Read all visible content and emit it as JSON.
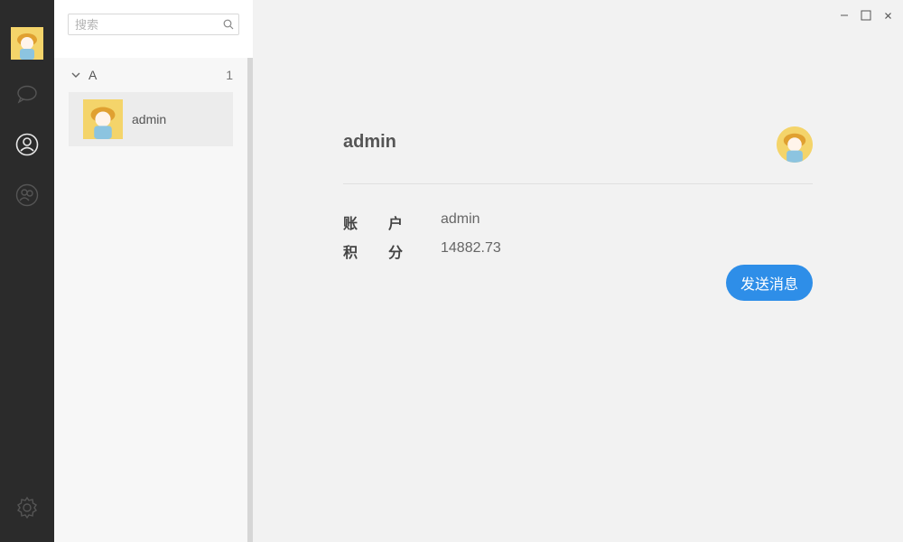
{
  "sidebar": {
    "nav": [
      {
        "name": "chat",
        "icon": "chat-bubble-icon"
      },
      {
        "name": "contacts",
        "icon": "user-icon",
        "active": true
      },
      {
        "name": "groups",
        "icon": "group-icon"
      }
    ],
    "settings_icon": "gear-icon"
  },
  "search": {
    "placeholder": "搜索"
  },
  "contact_groups": [
    {
      "name": "A",
      "count": "1",
      "contacts": [
        {
          "name": "admin"
        }
      ]
    }
  ],
  "window": {
    "minimize": "–",
    "maximize": "☐",
    "close": "×"
  },
  "detail": {
    "name": "admin",
    "fields": [
      {
        "label_a": "账",
        "label_b": "户",
        "value": "admin"
      },
      {
        "label_a": "积",
        "label_b": "分",
        "value": "14882.73"
      }
    ],
    "send_button": "发送消息"
  },
  "colors": {
    "rail": "#2b2b2b",
    "accent": "#2e8ee8",
    "avatar_bg": "#f4d46a"
  }
}
